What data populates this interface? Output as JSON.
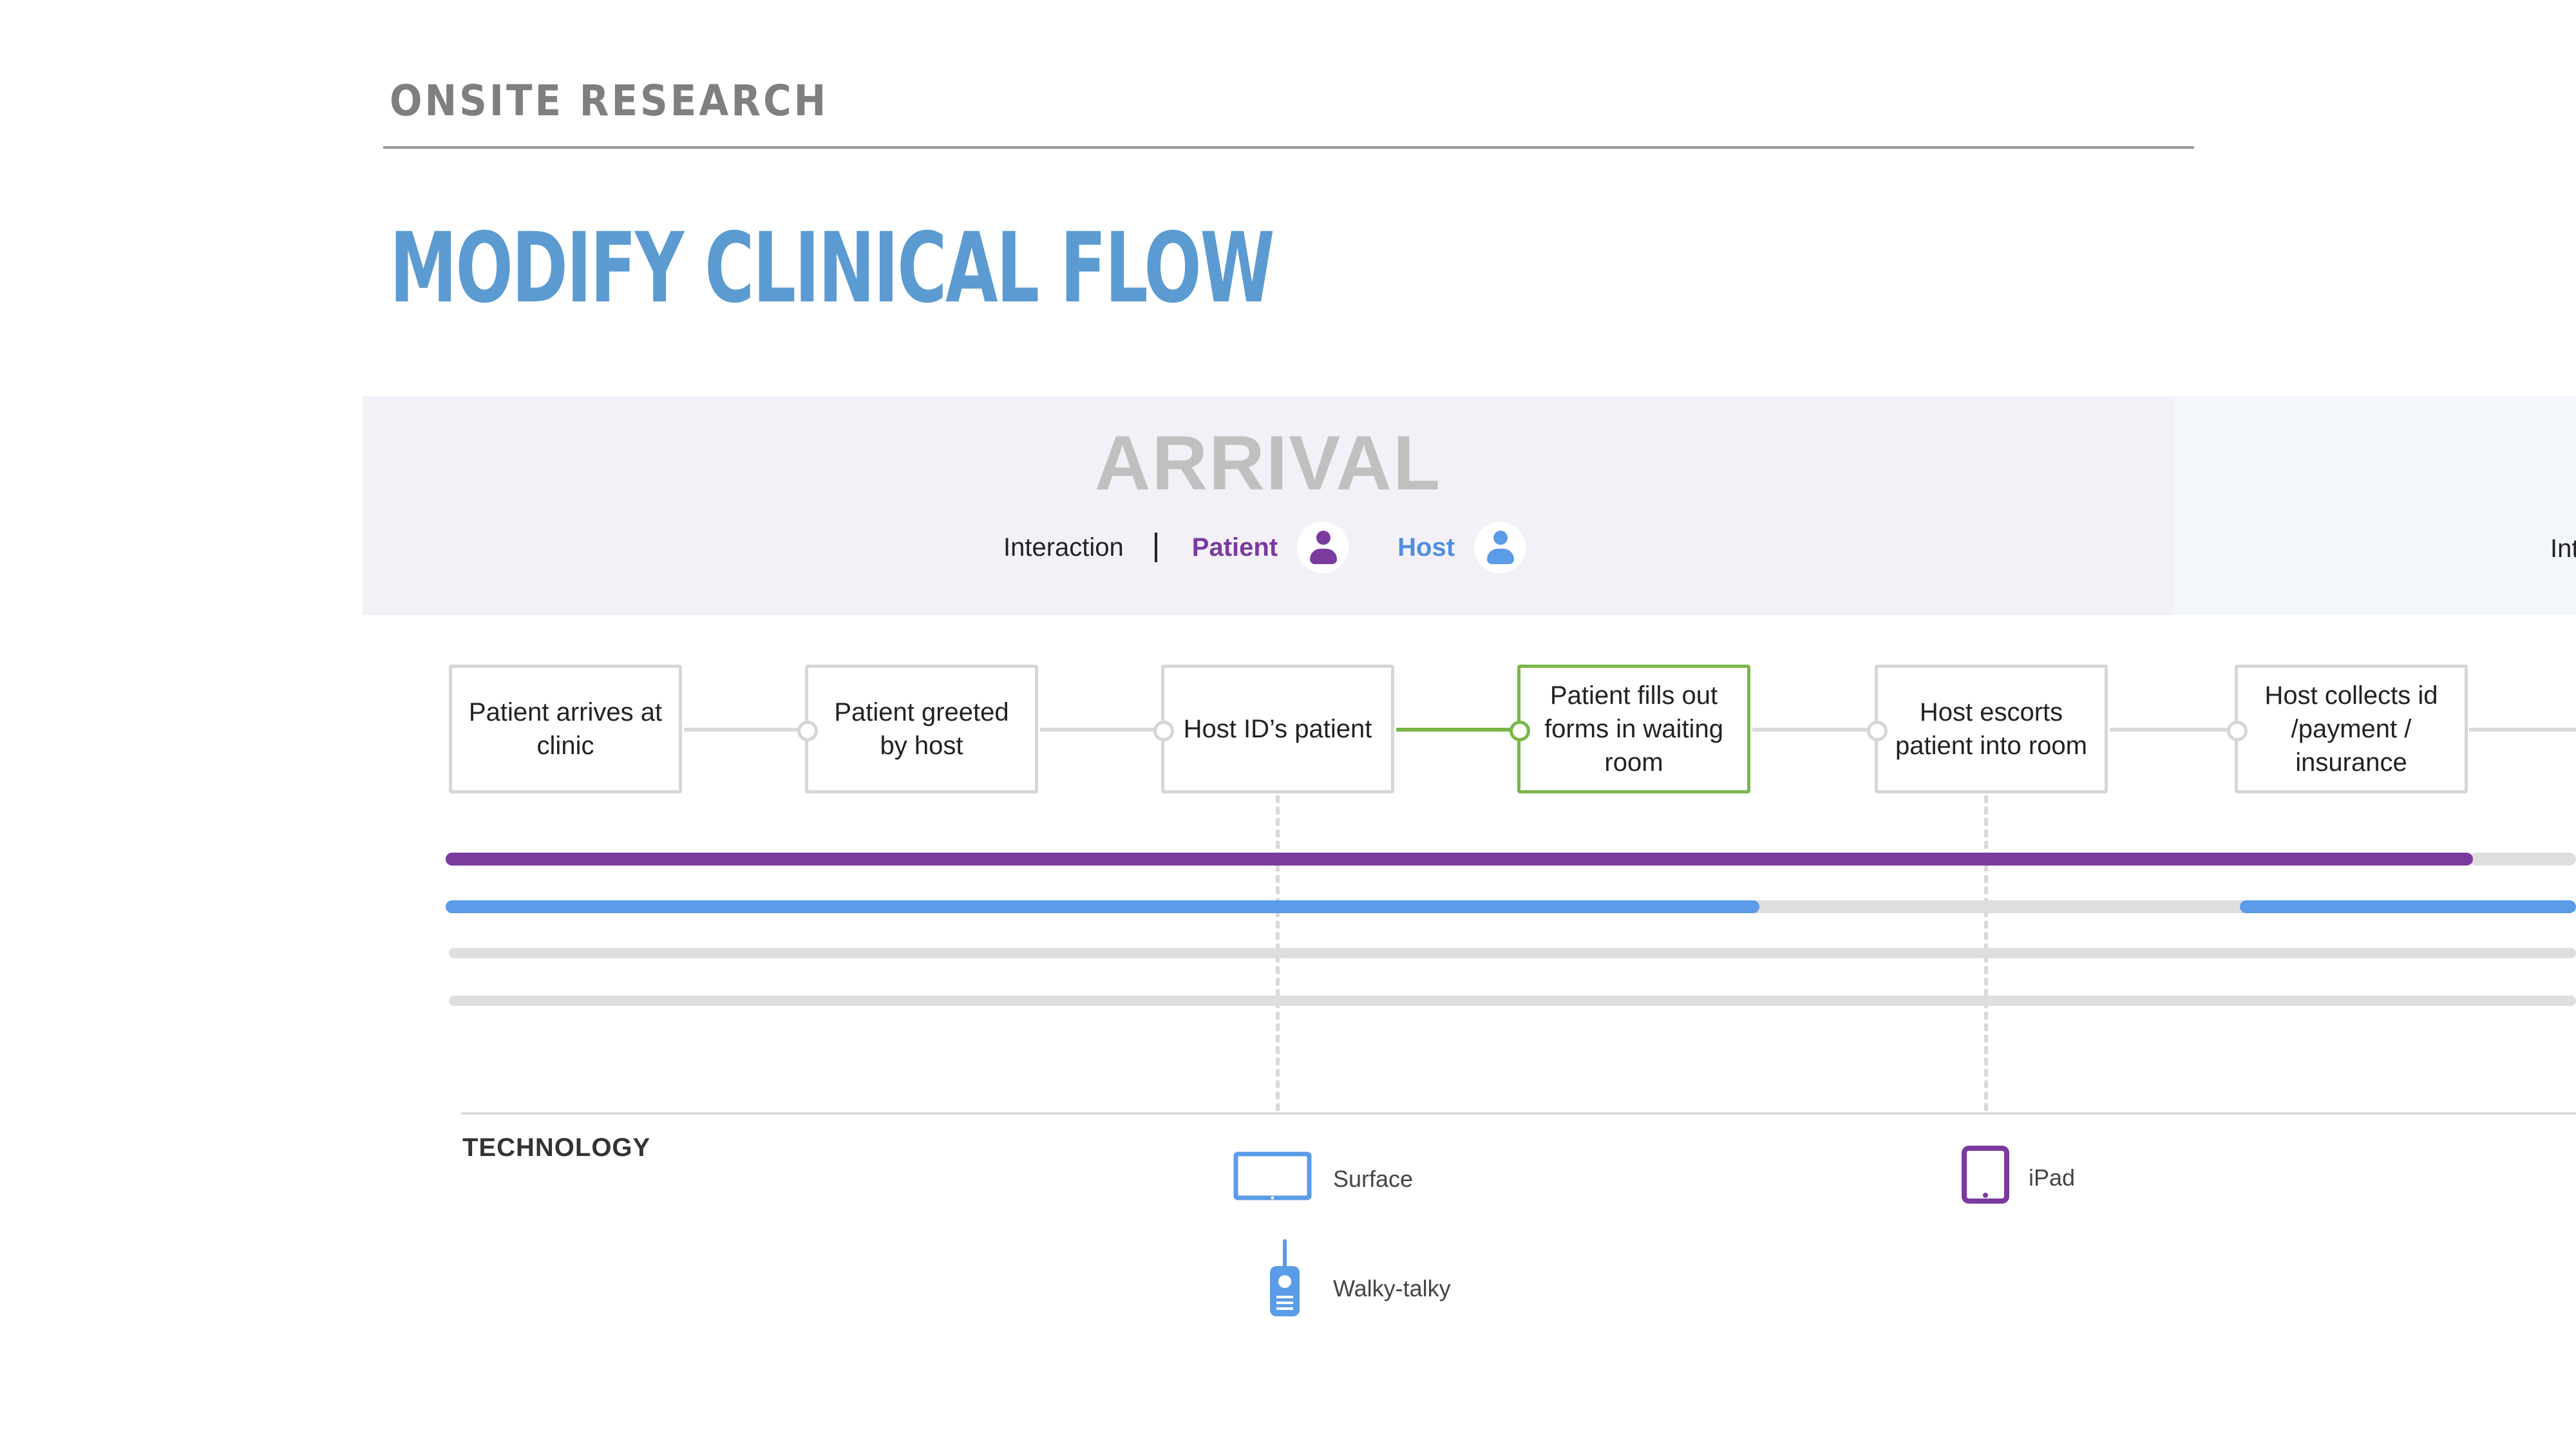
{
  "header": {
    "section_label": "ONSITE RESEARCH",
    "title": "MODIFY CLINICAL FLOW"
  },
  "phase": {
    "title": "ARRIVAL",
    "legend": {
      "interaction": "Interaction",
      "patient": "Patient",
      "host": "Host"
    },
    "next_phase_text_partial": "Int"
  },
  "steps": [
    {
      "label": "Patient arrives at clinic"
    },
    {
      "label": "Patient greeted by host"
    },
    {
      "label": "Host ID’s patient"
    },
    {
      "label": "Patient fills out forms in waiting room",
      "highlighted": true
    },
    {
      "label": "Host escorts patient into room"
    },
    {
      "label": "Host collects id /payment / insurance"
    }
  ],
  "technology": {
    "label": "TECHNOLOGY",
    "items": [
      {
        "name": "Surface",
        "icon": "tablet-landscape-icon"
      },
      {
        "name": "Walky-talky",
        "icon": "walkie-talkie-icon"
      },
      {
        "name": "iPad",
        "icon": "tablet-portrait-icon"
      }
    ]
  },
  "colors": {
    "title_blue": "#5b9bd1",
    "patient_purple": "#7a3a9e",
    "host_blue": "#5b9be8",
    "highlight_green": "#7ab648",
    "lane_gray": "#dedede",
    "band_lavender": "#f3f1f7"
  }
}
